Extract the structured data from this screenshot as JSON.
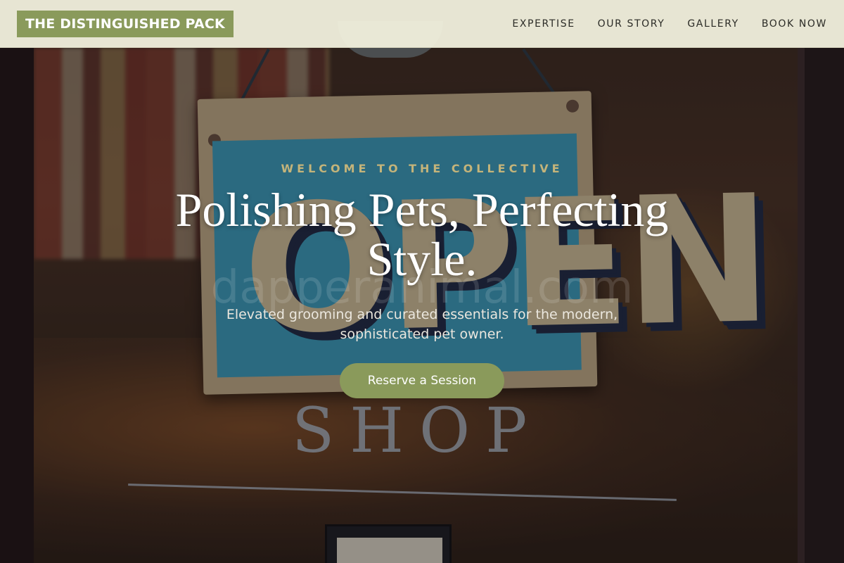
{
  "header": {
    "logo": "THE DISTINGUISHED PACK",
    "nav": [
      "EXPERTISE",
      "OUR STORY",
      "GALLERY",
      "BOOK NOW"
    ]
  },
  "hero": {
    "eyebrow": "WELCOME TO THE COLLECTIVE",
    "title": "Polishing Pets, Perfecting Style.",
    "subtitle": "Elevated grooming and curated essentials for the modern, sophisticated pet owner.",
    "cta": "Reserve a Session"
  },
  "background": {
    "sign_text": "OPEN",
    "door_text": "SHOP",
    "watermark": "dapperanimal.com"
  },
  "colors": {
    "accent": "#8a9a5b",
    "header_bg": "#f1f0dd",
    "eyebrow": "#c4b47a"
  }
}
